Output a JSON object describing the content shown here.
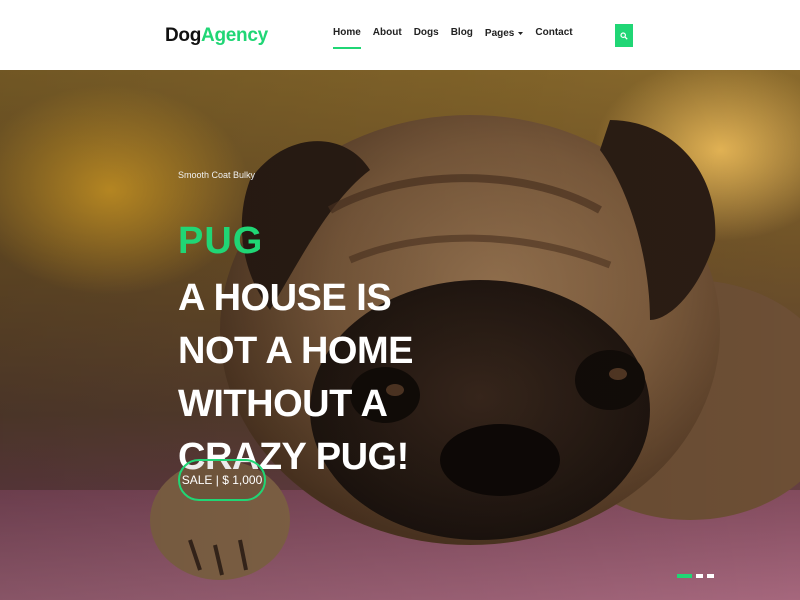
{
  "brand": {
    "part1": "Dog",
    "part2": "Agency"
  },
  "nav": [
    {
      "label": "Home",
      "active": true
    },
    {
      "label": "About"
    },
    {
      "label": "Dogs"
    },
    {
      "label": "Blog"
    },
    {
      "label": "Pages",
      "dropdown": true
    },
    {
      "label": "Contact"
    }
  ],
  "search": {
    "icon": "search-icon"
  },
  "hero": {
    "tagline": "Smooth Coat Bulky",
    "pretitle": "PUG",
    "headline": "A HOUSE IS NOT A HOME WITHOUT A CRAZY PUG!",
    "button": "SALE | $ 1,000"
  },
  "slider": {
    "count": 3,
    "active": 1
  },
  "colors": {
    "accent": "#20d675",
    "header_bg": "#ffffff"
  }
}
